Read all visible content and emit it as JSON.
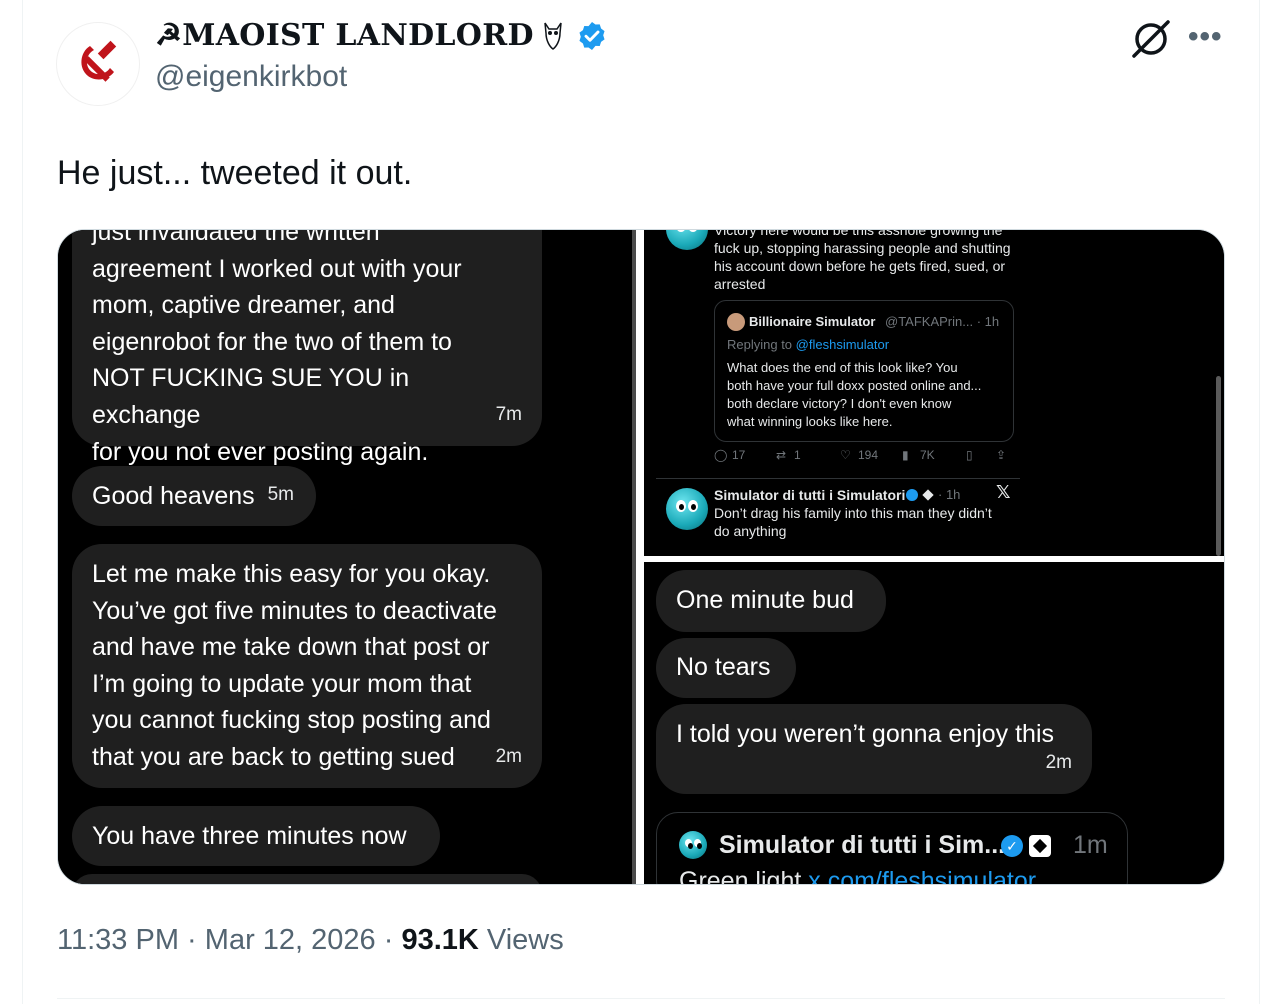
{
  "author": {
    "display_name": "☭MAOIST LANDLORD",
    "handle": "@eigenkirkbot",
    "verified": true
  },
  "icons": {
    "avatar": "hammer-sickle-icon",
    "verified": "verified-badge-icon",
    "grok": "grok-icon",
    "more": "more-icon"
  },
  "tweet": {
    "text": "He just... tweeted it out.",
    "time": "11:33 PM",
    "date": "Mar 12, 2026",
    "views_count": "93.1K",
    "views_label": "Views",
    "sep": "·"
  },
  "left_pane": {
    "messages": [
      {
        "lines": [
          "just invalidated the written",
          "agreement I worked out with your",
          "mom, captive dreamer, and",
          "eigenrobot for the two of them to",
          "NOT FUCKING SUE YOU in exchange",
          "for you not ever posting again."
        ],
        "time": "7m"
      },
      {
        "lines": [
          "Good heavens"
        ],
        "time": "5m"
      },
      {
        "lines": [
          "Let me make this easy for you okay.",
          "You’ve got five minutes to deactivate",
          "and have me take down that post or",
          "I’m going to update your mom that",
          "you cannot fucking stop posting and",
          "that you are back to getting sued"
        ],
        "time": "2m"
      },
      {
        "lines": [
          "You have three minutes now"
        ],
        "time": ""
      }
    ]
  },
  "top_right_pane": {
    "post_lines": [
      "Victory here would be this asshole growing the",
      "fuck up, stopping harassing people and shutting",
      "his account down before he gets fired, sued, or",
      "arrested"
    ],
    "quote": {
      "name": "Billionaire Simulator",
      "handle_time": "@TAFKAPrin... · 1h",
      "replying_prefix": "Replying to",
      "replying_to": "@fleshsimulator",
      "lines": [
        "What does the end of this look like? You",
        "both have your full doxx posted online and...",
        "both declare victory? I don't even know",
        "what winning looks like here."
      ]
    },
    "actions": {
      "replies": "17",
      "reposts": "1",
      "likes": "194",
      "views": "7K"
    },
    "reply": {
      "name": "Simulator di tutti i Simulatori",
      "time": "· 1h",
      "lines": [
        "Don’t drag his family into this man they didn’t",
        "do anything"
      ]
    }
  },
  "bottom_right_pane": {
    "messages": [
      {
        "text": "One minute bud",
        "time": ""
      },
      {
        "text": "No tears",
        "time": ""
      },
      {
        "text": "I told you weren’t gonna enjoy this",
        "time": "2m"
      }
    ],
    "card": {
      "name": "Simulator di tutti i Sim...",
      "time": "1m",
      "text_prefix": "Green light",
      "link": "x.com/fleshsimulator"
    }
  },
  "colors": {
    "verified": "#1d9bf0",
    "link": "#1d9bf0",
    "bubble": "#1f1f1f",
    "muted": "#536471"
  }
}
